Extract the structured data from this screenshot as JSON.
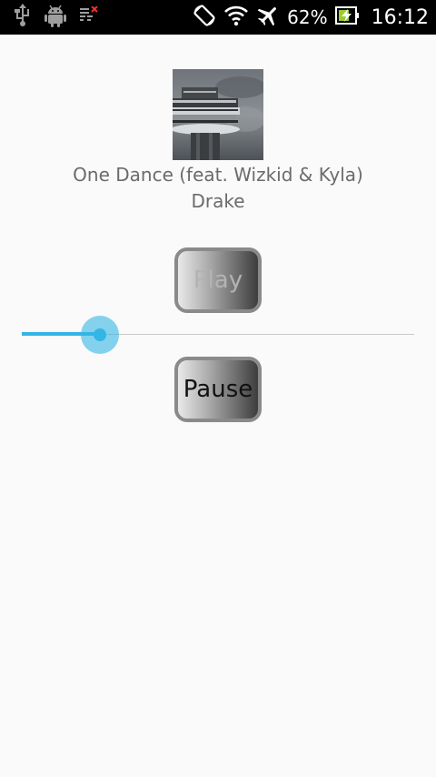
{
  "status_bar": {
    "left_icons": [
      "usb-icon",
      "android-debug-icon",
      "notification-icon"
    ],
    "right_icons": [
      "rotation-icon",
      "wifi-icon",
      "airplane-mode-icon",
      "battery-charging-icon"
    ],
    "battery": "62%",
    "time": "16:12"
  },
  "player": {
    "album_art_icon": "album-art-tower-image",
    "title": "One Dance (feat. Wizkid & Kyla)",
    "artist": "Drake",
    "play_label": "Play",
    "pause_label": "Pause",
    "seek_progress": 0.2
  },
  "colors": {
    "accent": "#33b5e5",
    "background": "#fafafa",
    "status_bar": "#000000",
    "text_secondary": "#6b6b6b"
  }
}
